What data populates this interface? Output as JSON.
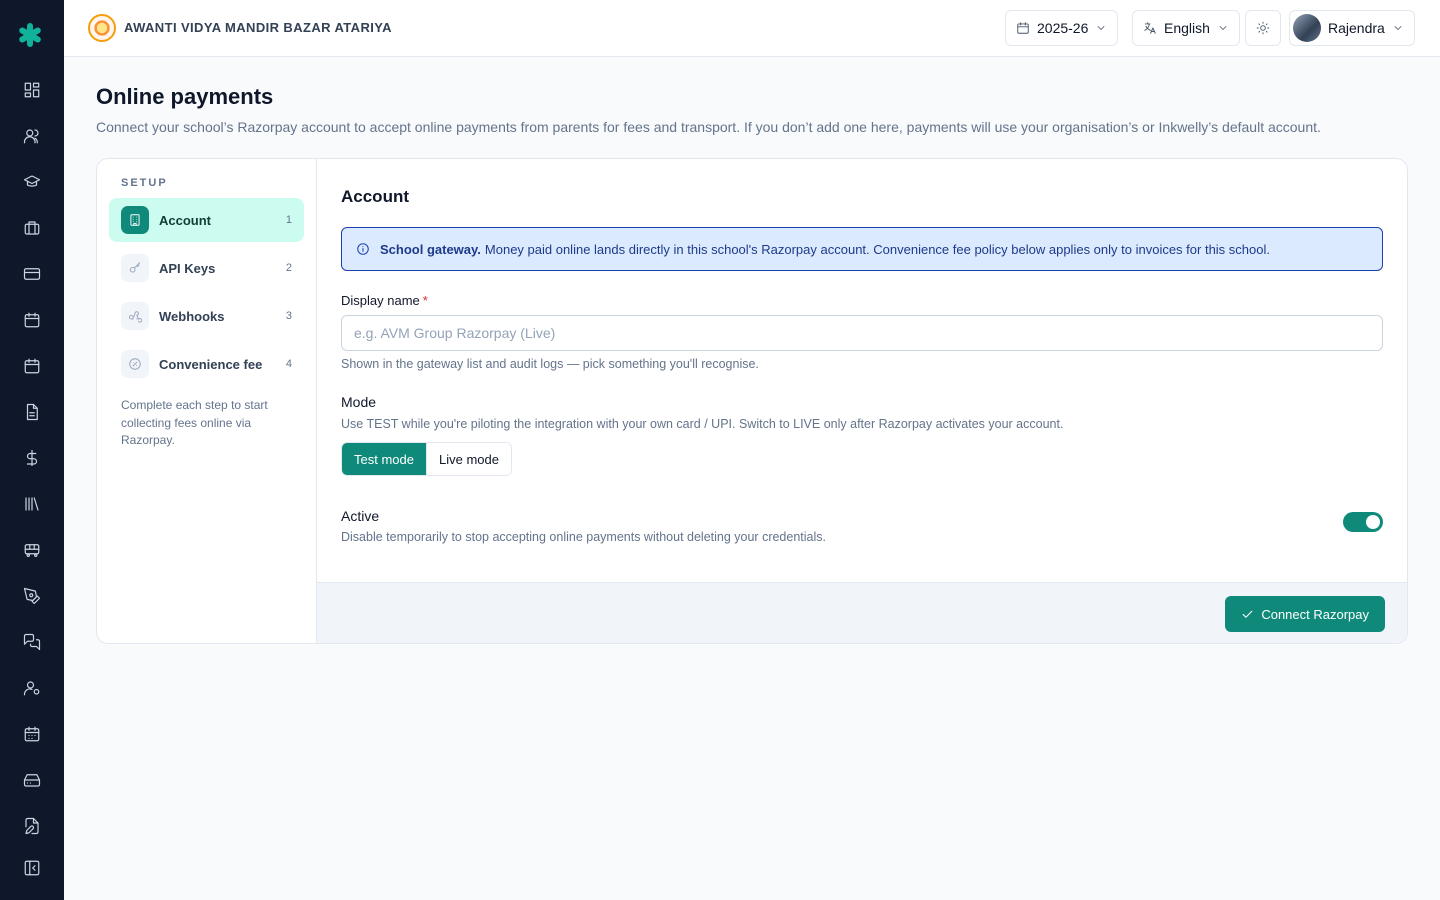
{
  "sidebar": {
    "logo_icon": "asterisk-logo-icon",
    "items": [
      {
        "icon": "dashboard-icon"
      },
      {
        "icon": "users-icon"
      },
      {
        "icon": "graduation-cap-icon"
      },
      {
        "icon": "briefcase-icon"
      },
      {
        "icon": "card-icon"
      },
      {
        "icon": "calendar-icon"
      },
      {
        "icon": "calendar-icon"
      },
      {
        "icon": "document-icon"
      },
      {
        "icon": "dollar-icon"
      },
      {
        "icon": "library-icon"
      },
      {
        "icon": "bus-icon"
      },
      {
        "icon": "pen-tool-icon"
      },
      {
        "icon": "messages-icon"
      },
      {
        "icon": "user-settings-icon"
      },
      {
        "icon": "calendar-grid-icon"
      },
      {
        "icon": "inbox-drive-icon"
      },
      {
        "icon": "file-edit-icon"
      },
      {
        "icon": "collapse-sidebar-icon"
      }
    ]
  },
  "header": {
    "school_name": "AWANTI VIDYA MANDIR BAZAR ATARIYA",
    "year": "2025-26",
    "language": "English",
    "user": "Rajendra"
  },
  "page": {
    "title": "Online payments",
    "description": "Connect your school’s Razorpay account to accept online payments from parents for fees and transport. If you don’t add one here, payments will use your organisation’s or Inkwelly’s default account."
  },
  "steps": {
    "title": "SETUP",
    "items": [
      {
        "label": "Account",
        "num": "1",
        "icon": "building-icon"
      },
      {
        "label": "API Keys",
        "num": "2",
        "icon": "key-icon"
      },
      {
        "label": "Webhooks",
        "num": "3",
        "icon": "webhook-icon"
      },
      {
        "label": "Convenience fee",
        "num": "4",
        "icon": "percent-icon"
      }
    ],
    "note": "Complete each step to start collecting fees online via Razorpay."
  },
  "form": {
    "section_title": "Account",
    "alert_bold": "School gateway.",
    "alert_text": "Money paid online lands directly in this school's Razorpay account. Convenience fee policy below applies only to invoices for this school.",
    "display_name_label": "Display name",
    "display_name_required": "*",
    "display_name_placeholder": "e.g. AVM Group Razorpay (Live)",
    "display_name_value": "",
    "display_name_hint": "Shown in the gateway list and audit logs — pick something you'll recognise.",
    "mode_label": "Mode",
    "mode_hint": "Use TEST while you're piloting the integration with your own card / UPI. Switch to LIVE only after Razorpay activates your account.",
    "mode_options": [
      "Test mode",
      "Live mode"
    ],
    "mode_selected": "Test mode",
    "active_label": "Active",
    "active_hint": "Disable temporarily to stop accepting online payments without deleting your credentials.",
    "active_on": true,
    "submit_label": "Connect Razorpay"
  },
  "colors": {
    "accent": "#0f8a7a",
    "sidebar_bg": "#0f172a",
    "alert_bg": "#dbeafe",
    "active_step_bg": "#ccfbef"
  }
}
